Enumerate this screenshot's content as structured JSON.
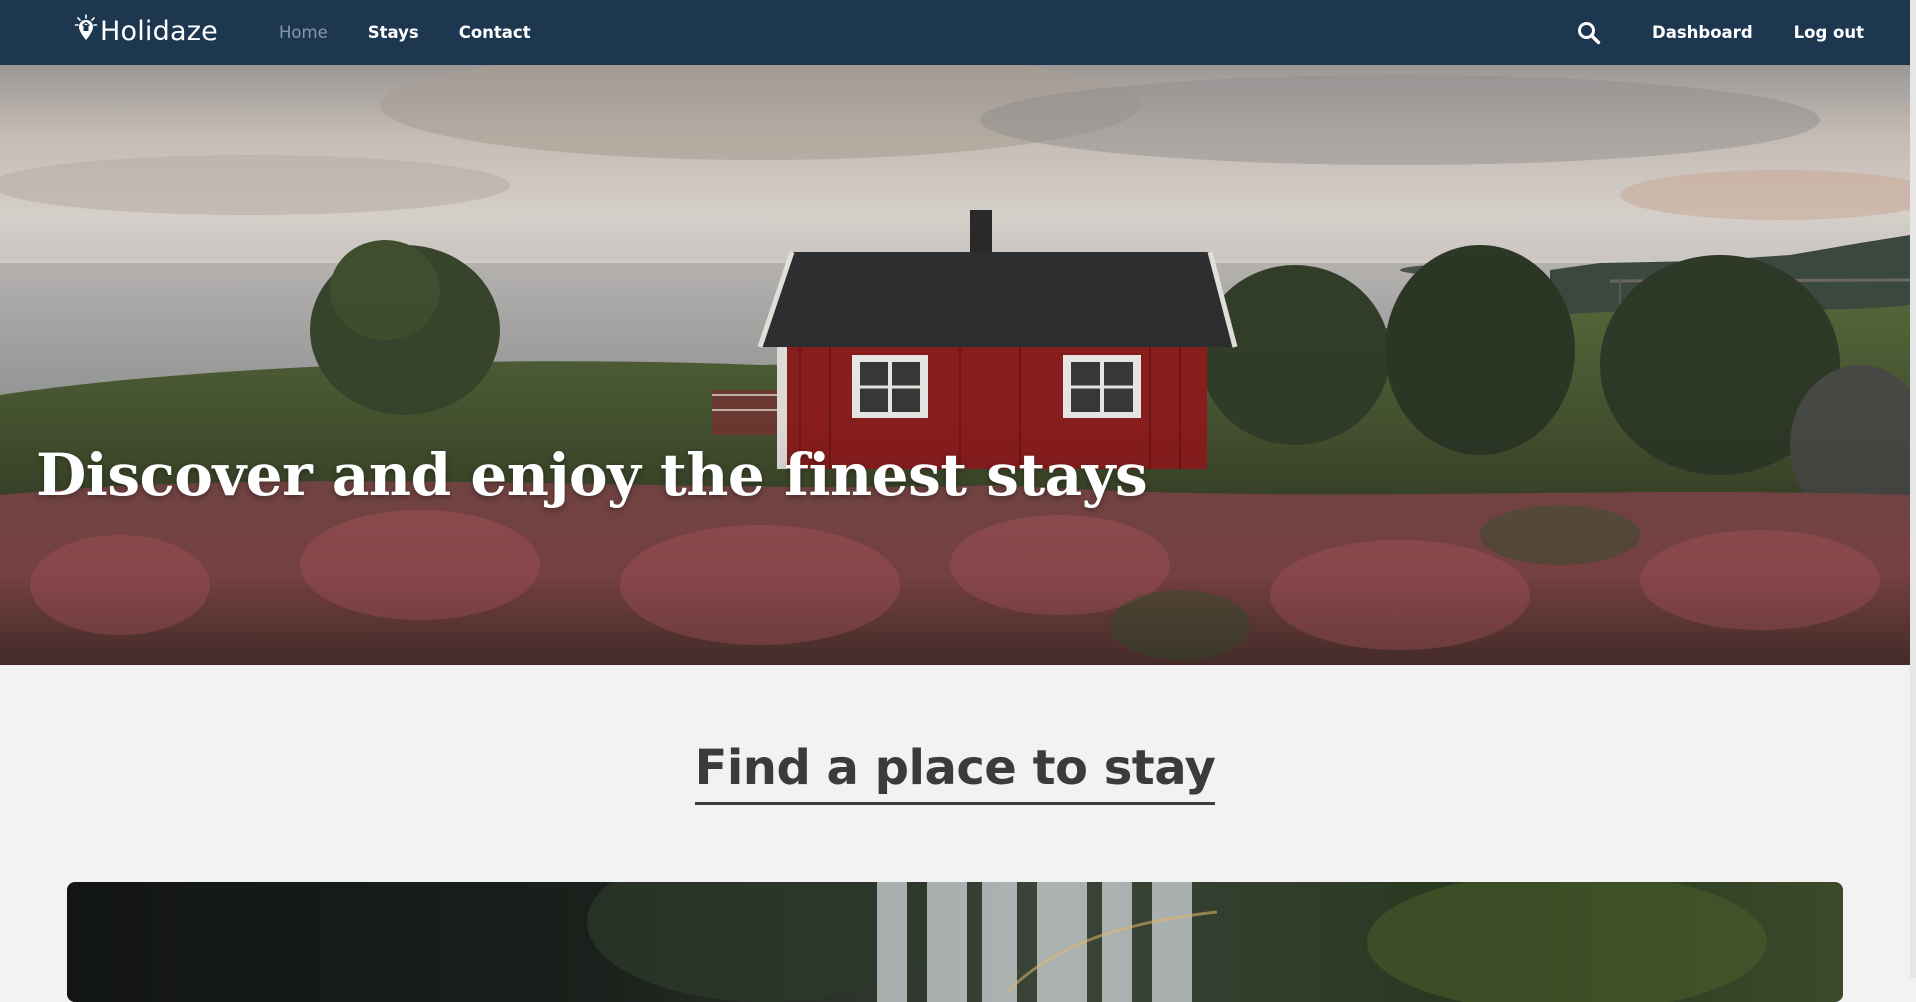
{
  "navbar": {
    "brand": "Holidaze",
    "links": [
      {
        "label": "Home",
        "active": true
      },
      {
        "label": "Stays",
        "active": false
      },
      {
        "label": "Contact",
        "active": false
      }
    ],
    "right_links": [
      {
        "label": "Dashboard"
      },
      {
        "label": "Log out"
      }
    ],
    "search_icon": "search-icon",
    "colors": {
      "background": "#1e3750",
      "text": "#ffffff",
      "active": "#8a98a8"
    }
  },
  "hero": {
    "title": "Discover and enjoy the finest stays"
  },
  "main": {
    "section_title": "Find a place to stay"
  },
  "colors": {
    "page_background": "#f2f2f2",
    "heading": "#3b3b3b"
  }
}
